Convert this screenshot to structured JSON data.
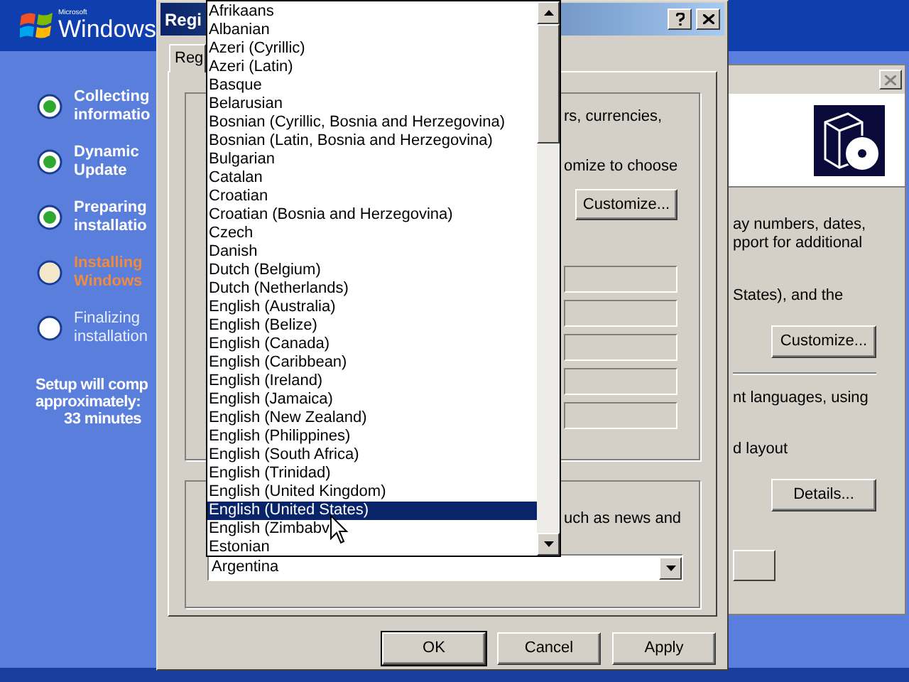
{
  "setup": {
    "brand_small": "Microsoft",
    "brand": "Windows",
    "steps": [
      {
        "lines": [
          "Collecting",
          "informatio"
        ],
        "kind": "done"
      },
      {
        "lines": [
          "Dynamic",
          "Update"
        ],
        "kind": "done"
      },
      {
        "lines": [
          "Preparing",
          "installatio"
        ],
        "kind": "done"
      },
      {
        "lines": [
          "Installing",
          "Windows"
        ],
        "kind": "current"
      },
      {
        "lines": [
          "Finalizing",
          "installation"
        ],
        "kind": "pending"
      }
    ],
    "estimate": [
      "Setup will comp",
      "approximately:",
      "33 minutes"
    ]
  },
  "back_window": {
    "texts_1": [
      "ay numbers, dates,",
      "pport for additional"
    ],
    "text_2": "States), and the",
    "customize_button": "Customize...",
    "text_3": "nt languages, using",
    "text_4": "d layout",
    "details_button": "Details..."
  },
  "dialog": {
    "title": "Regi",
    "tab": {
      "label": "Reg",
      "selected": true
    },
    "group_1": {
      "text_1": "rs, currencies,",
      "text_2": "omize to choose",
      "customize_button": "Customize..."
    },
    "group_2": {
      "text": "uch as news and",
      "combo_value": "Argentina"
    },
    "buttons": [
      "OK",
      "Cancel",
      "Apply"
    ]
  },
  "dropdown": {
    "items": [
      {
        "label": "Afrikaans",
        "selected": false
      },
      {
        "label": "Albanian",
        "selected": false
      },
      {
        "label": "Azeri (Cyrillic)",
        "selected": false
      },
      {
        "label": "Azeri (Latin)",
        "selected": false
      },
      {
        "label": "Basque",
        "selected": false
      },
      {
        "label": "Belarusian",
        "selected": false
      },
      {
        "label": "Bosnian (Cyrillic, Bosnia and Herzegovina)",
        "selected": false
      },
      {
        "label": "Bosnian (Latin, Bosnia and Herzegovina)",
        "selected": false
      },
      {
        "label": "Bulgarian",
        "selected": false
      },
      {
        "label": "Catalan",
        "selected": false
      },
      {
        "label": "Croatian",
        "selected": false
      },
      {
        "label": "Croatian (Bosnia and Herzegovina)",
        "selected": false
      },
      {
        "label": "Czech",
        "selected": false
      },
      {
        "label": "Danish",
        "selected": false
      },
      {
        "label": "Dutch (Belgium)",
        "selected": false
      },
      {
        "label": "Dutch (Netherlands)",
        "selected": false
      },
      {
        "label": "English (Australia)",
        "selected": false
      },
      {
        "label": "English (Belize)",
        "selected": false
      },
      {
        "label": "English (Canada)",
        "selected": false
      },
      {
        "label": "English (Caribbean)",
        "selected": false
      },
      {
        "label": "English (Ireland)",
        "selected": false
      },
      {
        "label": "English (Jamaica)",
        "selected": false
      },
      {
        "label": "English (New Zealand)",
        "selected": false
      },
      {
        "label": "English (Philippines)",
        "selected": false
      },
      {
        "label": "English (South Africa)",
        "selected": false
      },
      {
        "label": "English (Trinidad)",
        "selected": false
      },
      {
        "label": "English (United Kingdom)",
        "selected": false
      },
      {
        "label": "English (United States)",
        "selected": true
      },
      {
        "label": "English (Zimbabv",
        "selected": false
      },
      {
        "label": "Estonian",
        "selected": false
      }
    ]
  }
}
